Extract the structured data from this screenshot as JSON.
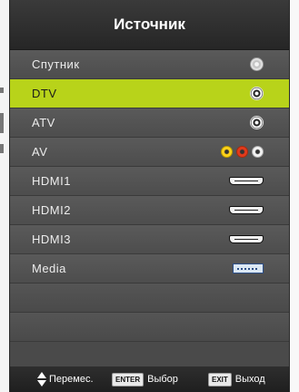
{
  "menu": {
    "title": "Источник",
    "selected_index": 1,
    "items": [
      {
        "label": "Спутник",
        "icon": "satellite-input-icon"
      },
      {
        "label": "DTV",
        "icon": "antenna-input-icon"
      },
      {
        "label": "ATV",
        "icon": "antenna-input-icon"
      },
      {
        "label": "AV",
        "icon": "rca-composite-icon"
      },
      {
        "label": "HDMI1",
        "icon": "hdmi-port-icon"
      },
      {
        "label": "HDMI2",
        "icon": "hdmi-port-icon"
      },
      {
        "label": "HDMI3",
        "icon": "hdmi-port-icon"
      },
      {
        "label": "Media",
        "icon": "usb-port-icon"
      }
    ],
    "empty_rows": 2
  },
  "footer": {
    "move_label": "Перемес.",
    "enter_key": "ENTER",
    "enter_label": "Выбор",
    "exit_key": "EXIT",
    "exit_label": "Выход"
  },
  "colors": {
    "highlight": "#b8d31a",
    "panel": "#4a4a4a",
    "title_bar": "#2a2a2a"
  }
}
